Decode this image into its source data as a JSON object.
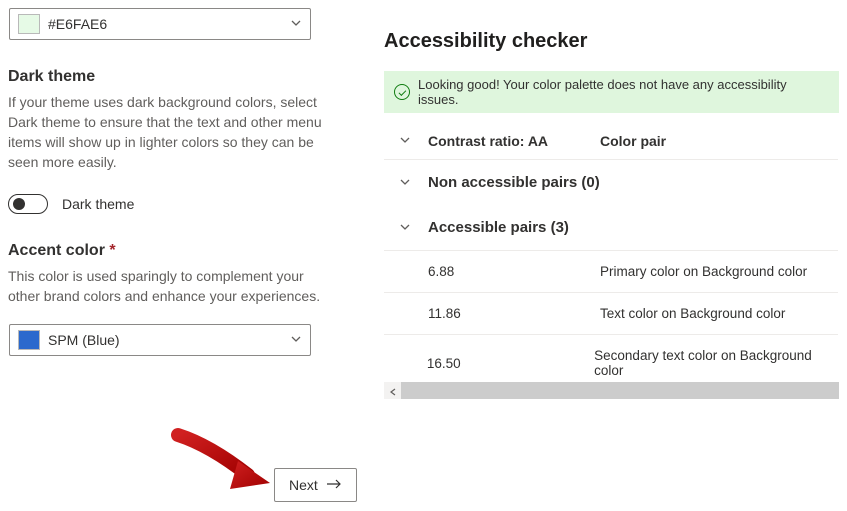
{
  "left": {
    "color_dropdown": {
      "value": "#E6FAE6",
      "swatch_color": "#e6fae6"
    },
    "dark_theme": {
      "heading": "Dark theme",
      "description": "If your theme uses dark background colors, select Dark theme to ensure that the text and other menu items will show up in lighter colors so they can be seen more easily.",
      "toggle_label": "Dark theme",
      "toggle_on": false
    },
    "accent": {
      "heading": "Accent color",
      "required": true,
      "description": "This color is used sparingly to complement your other brand colors and enhance your experiences.",
      "dropdown_value": "SPM (Blue)",
      "swatch_color": "#2b69cd"
    },
    "next_label": "Next"
  },
  "accessibility": {
    "title": "Accessibility checker",
    "success_message": "Looking good! Your color palette does not have any accessibility issues.",
    "columns": {
      "ratio": "Contrast ratio: AA",
      "pair": "Color pair"
    },
    "groups": [
      {
        "label": "Non accessible pairs (0)",
        "expanded": false,
        "rows": []
      },
      {
        "label": "Accessible pairs (3)",
        "expanded": true,
        "rows": [
          {
            "ratio": "6.88",
            "pair": "Primary color on Background color"
          },
          {
            "ratio": "11.86",
            "pair": "Text color on Background color"
          },
          {
            "ratio": "16.50",
            "pair": "Secondary text color on Background color"
          }
        ]
      }
    ]
  }
}
